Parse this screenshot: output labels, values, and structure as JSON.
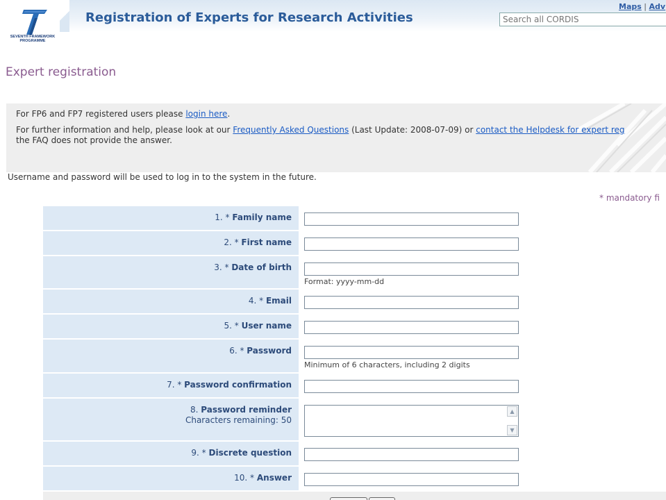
{
  "header": {
    "logo_text": "SEVENTH FRAMEWORK PROGRAMME",
    "site_title": "Registration of Experts for Research Activities",
    "links": [
      "Maps",
      "Adv"
    ],
    "link_separator": "|",
    "search": {
      "placeholder": "Search all CORDIS",
      "value": ""
    }
  },
  "page": {
    "title": "Expert registration",
    "info": {
      "line1_prefix": "For FP6 and FP7 registered users please ",
      "line1_link": "login here",
      "line1_suffix": ".",
      "line2_prefix": "For further information and help, please look at our ",
      "line2_link1": "Frequently Asked Questions",
      "line2_mid": " (Last Update: 2008-07-09) or ",
      "line2_link2": "contact the Helpdesk for expert reg",
      "line2_suffix": "the FAQ does not provide the answer."
    },
    "note": "Username and password will be used to log in to the system in the future.",
    "mandatory_note": "* mandatory fi"
  },
  "form": {
    "fields": [
      {
        "num": "1. *",
        "label": "Family name",
        "value": ""
      },
      {
        "num": "2. *",
        "label": "First name",
        "value": ""
      },
      {
        "num": "3. *",
        "label": "Date of birth",
        "value": "",
        "hint": "Format: yyyy-mm-dd"
      },
      {
        "num": "4. *",
        "label": "Email",
        "value": ""
      },
      {
        "num": "5. *",
        "label": "User name",
        "value": ""
      },
      {
        "num": "6. *",
        "label": "Password",
        "value": "",
        "hint": "Minimum of 6 characters, including 2 digits"
      },
      {
        "num": "7. *",
        "label": "Password confirmation",
        "value": ""
      },
      {
        "num": "8.",
        "label": "Password reminder",
        "sub": "Characters remaining: 50",
        "value": ""
      },
      {
        "num": "9. *",
        "label": "Discrete question",
        "value": ""
      },
      {
        "num": "10. *",
        "label": "Answer",
        "value": ""
      }
    ]
  },
  "colors": {
    "accent": "#2b5c9a",
    "title": "#8a5b8f",
    "label_bg": "#dde9f5",
    "info_bg": "#eeeeee",
    "link": "#1a5bc4"
  }
}
